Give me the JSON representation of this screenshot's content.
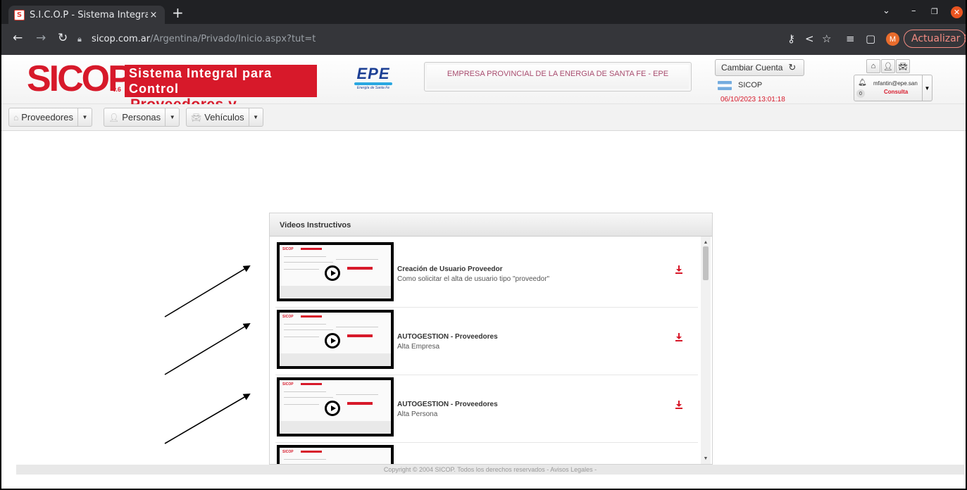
{
  "browser": {
    "tab_title": "S.I.C.O.P - Sistema Integra",
    "favicon_letter": "S",
    "tab_close": "×",
    "new_tab": "+",
    "url_host": "sicop.com.ar",
    "url_path": "/Argentina/Privado/Inicio.aspx?tut=t",
    "profile_initial": "M",
    "update_label": "Actualizar",
    "update_menu": "⋮"
  },
  "header": {
    "logo_main": "SICOP",
    "logo_version": "v.6",
    "logo_line1": "Sistema Integral para Control",
    "logo_line2": "Proveedores y Contratistas",
    "epe_logo": "EPE",
    "epe_subtitle": "Energía de Santa Fe",
    "company": "EMPRESA PROVINCIAL DE LA ENERGIA DE SANTA FE - EPE",
    "cambiar_label": "Cambiar Cuenta",
    "sicop_label": "SICOP",
    "datetime": "06/10/2023 13:01:18",
    "user_email": "mfantin@epe.san",
    "user_role": "Consulta",
    "notif_count": "0"
  },
  "menu": [
    {
      "label": "Proveedores"
    },
    {
      "label": "Personas"
    },
    {
      "label": "Vehículos"
    }
  ],
  "videos": {
    "title": "Videos Instructivos",
    "items": [
      {
        "title": "Creación de Usuario Proveedor",
        "subtitle": "Como solicitar el alta de usuario tipo \"proveedor\""
      },
      {
        "title": "AUTOGESTION - Proveedores",
        "subtitle": "Alta Empresa"
      },
      {
        "title": "AUTOGESTION - Proveedores",
        "subtitle": "Alta Persona"
      },
      {
        "title": "",
        "subtitle": ""
      }
    ]
  },
  "footer": "Copyright © 2004 SICOP. Todos los derechos reservados - Avisos Legales -",
  "colors": {
    "brand_red": "#d7192a",
    "epe_blue": "#1c3f94"
  }
}
